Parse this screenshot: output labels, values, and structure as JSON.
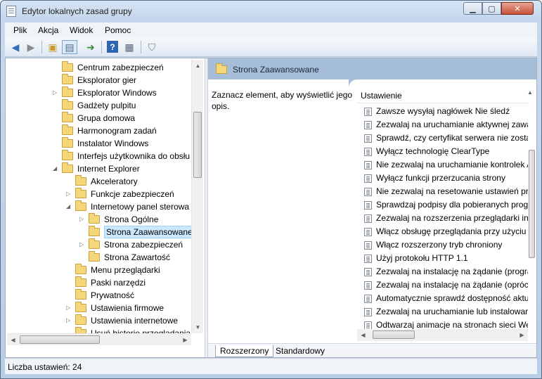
{
  "window": {
    "title": "Edytor lokalnych zasad grupy"
  },
  "menu": [
    "Plik",
    "Akcja",
    "Widok",
    "Pomoc"
  ],
  "toolbar": {
    "icons": [
      "back-arrow-icon",
      "forward-arrow-icon",
      "up-folder-icon",
      "show-hide-tree-icon",
      "export-list-icon",
      "help-icon",
      "properties-icon",
      "filter-icon"
    ]
  },
  "tree": {
    "items": [
      {
        "label": "Centrum zabezpieczeń",
        "arrow": ""
      },
      {
        "label": "Eksplorator gier",
        "arrow": ""
      },
      {
        "label": "Eksplorator Windows",
        "arrow": "▷"
      },
      {
        "label": "Gadżety pulpitu",
        "arrow": ""
      },
      {
        "label": "Grupa domowa",
        "arrow": ""
      },
      {
        "label": "Harmonogram zadań",
        "arrow": ""
      },
      {
        "label": "Instalator Windows",
        "arrow": ""
      },
      {
        "label": "Interfejs użytkownika do obsłu",
        "arrow": ""
      },
      {
        "label": "Internet Explorer",
        "arrow": "◢"
      },
      {
        "label": "Akceleratory",
        "arrow": ""
      },
      {
        "label": "Funkcje zabezpieczeń",
        "arrow": "▷"
      },
      {
        "label": "Internetowy panel sterowa",
        "arrow": "◢"
      },
      {
        "label": "Strona Ogólne",
        "arrow": "▷"
      },
      {
        "label": "Strona Zaawansowane",
        "arrow": ""
      },
      {
        "label": "Strona zabezpieczeń",
        "arrow": "▷"
      },
      {
        "label": "Strona Zawartość",
        "arrow": ""
      },
      {
        "label": "Menu przeglądarki",
        "arrow": ""
      },
      {
        "label": "Paski narzędzi",
        "arrow": ""
      },
      {
        "label": "Prywatność",
        "arrow": ""
      },
      {
        "label": "Ustawienia firmowe",
        "arrow": "▷"
      },
      {
        "label": "Ustawienia internetowe",
        "arrow": "▷"
      },
      {
        "label": "Usuń historię przeglądania",
        "arrow": ""
      }
    ],
    "selected_index": 13
  },
  "right": {
    "header": "Strona Zaawansowane",
    "description": "Zaznacz element, aby wyświetlić jego opis.",
    "column_header": "Ustawienie",
    "settings": [
      "Zawsze wysyłaj nagłówek Nie śledź",
      "Zezwalaj na uruchamianie aktywnej zawa",
      "Sprawdź, czy certyfikat serwera nie został",
      "Wyłącz technologię ClearType",
      "Nie zezwalaj na uruchamianie kontrolek A",
      "Wyłącz funkcji przerzucania strony",
      "Nie zezwalaj na resetowanie ustawień pro",
      "Sprawdzaj podpisy dla pobieranych prog",
      "Zezwalaj na rozszerzenia przeglądarki inn",
      "Włącz obsługę przeglądania przy użyciu k",
      "Włącz rozszerzony tryb chroniony",
      "Użyj protokołu HTTP 1.1",
      "Zezwalaj na instalację na żądanie (progra",
      "Zezwalaj na instalację na żądanie (oprócz",
      "Automatycznie sprawdź dostępność aktu",
      "Zezwalaj na uruchamianie lub instalowar",
      "Odtwarzaj animacje na stronach sieci We"
    ],
    "tabs": [
      "Rozszerzony",
      "Standardowy"
    ]
  },
  "status": {
    "text": "Liczba ustawień: 24"
  }
}
